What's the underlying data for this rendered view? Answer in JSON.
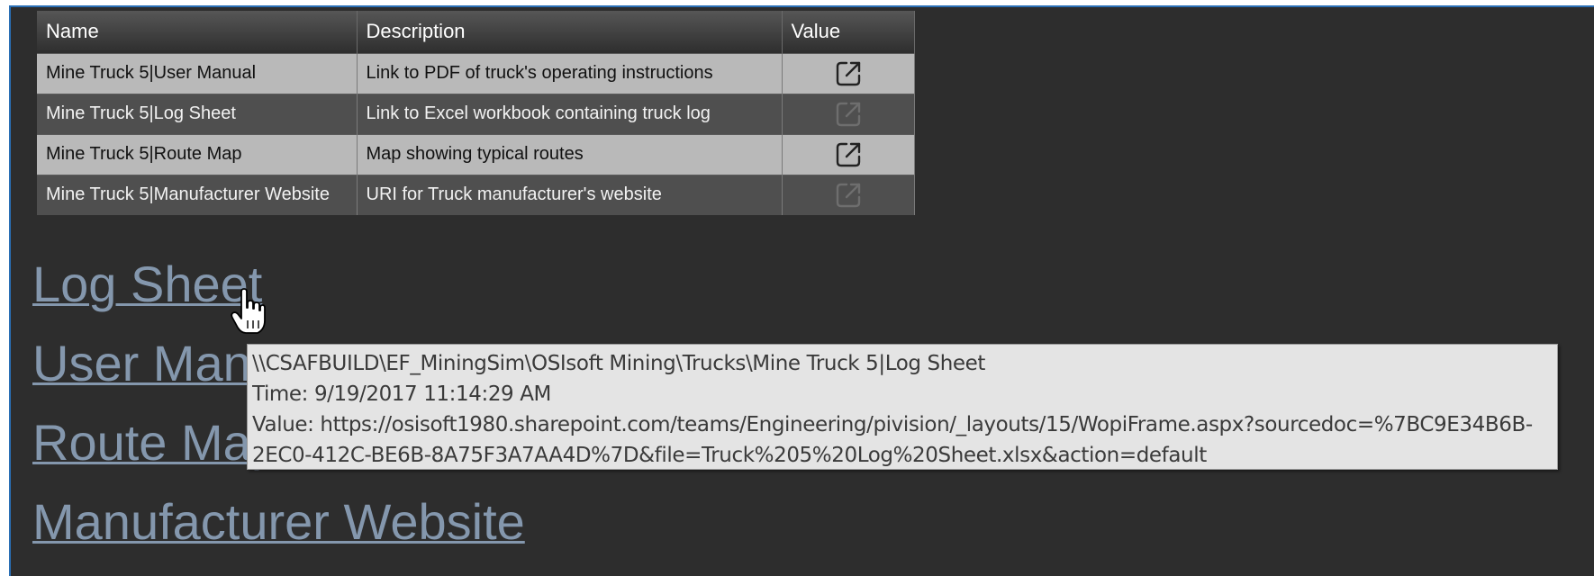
{
  "table": {
    "headers": {
      "name": "Name",
      "description": "Description",
      "value": "Value"
    },
    "rows": [
      {
        "name": "Mine Truck 5|User Manual",
        "description": "Link to PDF of truck's operating instructions",
        "value_icon": "external-link-icon",
        "enabled": true
      },
      {
        "name": "Mine Truck 5|Log Sheet",
        "description": "Link to Excel workbook containing truck log",
        "value_icon": "external-link-icon",
        "enabled": false
      },
      {
        "name": "Mine Truck 5|Route Map",
        "description": "Map showing typical routes",
        "value_icon": "external-link-icon",
        "enabled": true
      },
      {
        "name": "Mine Truck 5|Manufacturer Website",
        "description": "URI for Truck manufacturer's website",
        "value_icon": "external-link-icon",
        "enabled": false
      }
    ]
  },
  "links": {
    "log_sheet": "Log Sheet",
    "user_manual": "User Manual",
    "route_map": "Route Map",
    "manufacturer_website": "Manufacturer Website"
  },
  "tooltip": {
    "path": "\\\\CSAFBUILD\\EF_MiningSim\\OSIsoft Mining\\Trucks\\Mine Truck 5|Log Sheet",
    "time": "Time: 9/19/2017 11:14:29 AM",
    "value_line1": "Value: https://osisoft1980.sharepoint.com/teams/Engineering/pivision/_layouts/15/WopiFrame.aspx?sourcedoc=%7BC9E34B6B-",
    "value_line2": "2EC0-412C-BE6B-8A75F3A7AA4D%7D&file=Truck%205%20Log%20Sheet.xlsx&action=default"
  },
  "colors": {
    "background": "#2d2d2d",
    "frame_border": "#2a6fb5",
    "link": "#8497ad",
    "tooltip_bg": "#e4e4e4"
  }
}
